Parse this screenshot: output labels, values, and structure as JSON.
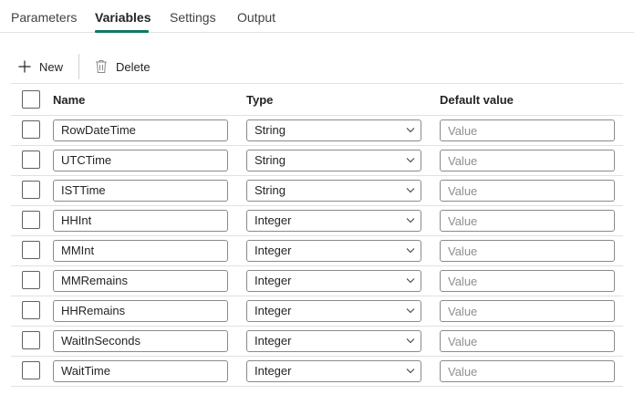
{
  "tabs": [
    {
      "label": "Parameters"
    },
    {
      "label": "Variables"
    },
    {
      "label": "Settings"
    },
    {
      "label": "Output"
    }
  ],
  "active_tab": "Variables",
  "toolbar": {
    "new_label": "New",
    "delete_label": "Delete"
  },
  "columns": {
    "name": "Name",
    "type": "Type",
    "default": "Default value"
  },
  "rows": [
    {
      "name": "RowDateTime",
      "type": "String",
      "placeholder": "Value"
    },
    {
      "name": "UTCTime",
      "type": "String",
      "placeholder": "Value"
    },
    {
      "name": "ISTTime",
      "type": "String",
      "placeholder": "Value"
    },
    {
      "name": "HHInt",
      "type": "Integer",
      "placeholder": "Value"
    },
    {
      "name": "MMInt",
      "type": "Integer",
      "placeholder": "Value"
    },
    {
      "name": "MMRemains",
      "type": "Integer",
      "placeholder": "Value"
    },
    {
      "name": "HHRemains",
      "type": "Integer",
      "placeholder": "Value"
    },
    {
      "name": "WaitInSeconds",
      "type": "Integer",
      "placeholder": "Value"
    },
    {
      "name": "WaitTime",
      "type": "Integer",
      "placeholder": "Value"
    }
  ],
  "colors": {
    "accent": "#117865",
    "border": "#e1e1e1",
    "text": "#242424",
    "placeholder": "#8f8f8f"
  }
}
